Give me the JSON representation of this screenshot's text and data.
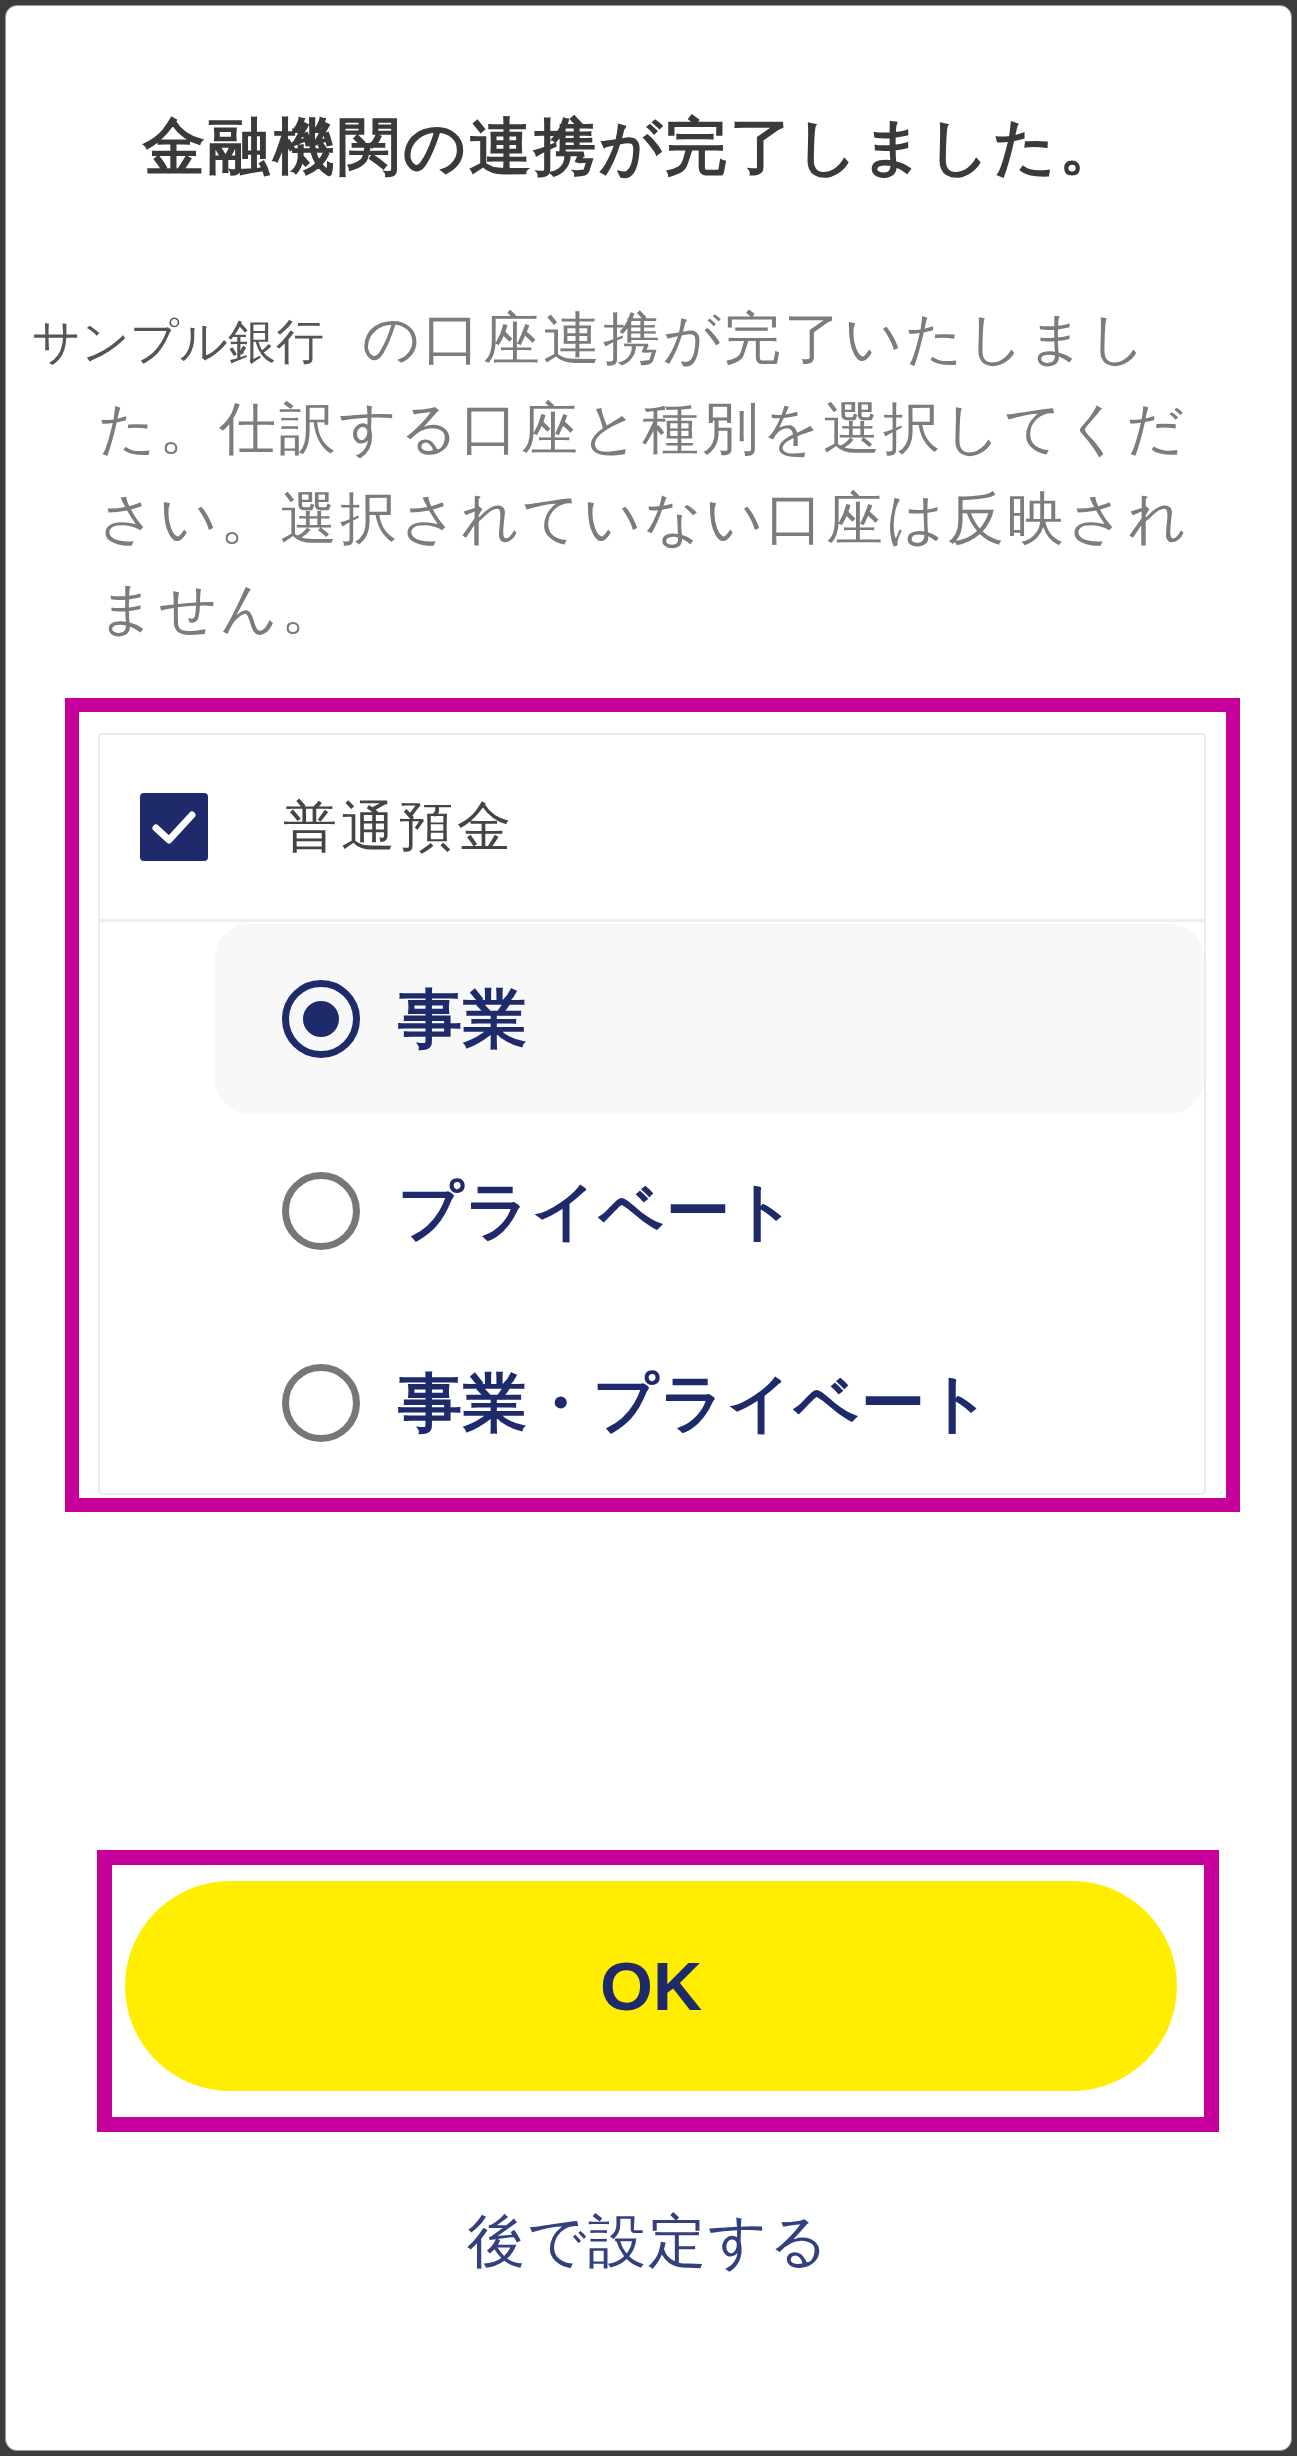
{
  "dialog": {
    "title": "金融機関の連携が完了しました。",
    "message": {
      "bank_name": "サンプル銀行",
      "text": "の口座連携が完了いたしました。仕訳する口座と種別を選択してください。選択されていない口座は反映されません。"
    }
  },
  "account": {
    "label": "普通預金",
    "checked": true,
    "highlighted": true
  },
  "categories": [
    {
      "label": "事業",
      "selected": true
    },
    {
      "label": "プライベート",
      "selected": false
    },
    {
      "label": "事業・プライベート",
      "selected": false
    }
  ],
  "ok_button": {
    "label": "OK",
    "highlighted": true
  },
  "later_link": {
    "label": "後で設定する"
  }
}
